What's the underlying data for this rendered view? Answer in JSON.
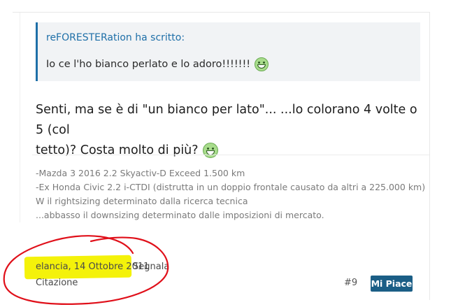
{
  "quote": {
    "author": "reFORESTERation ha scritto:",
    "text": "Io ce l'ho bianco perlato e lo adoro!!!!!!!",
    "emoji": "grin-icon"
  },
  "post": {
    "body_line1": "Senti, ma se è di \"un bianco per lato\"... ...lo colorano 4 volte o 5 (col",
    "body_line2": "tetto)? Costa molto di più?",
    "emoji": "grin-icon"
  },
  "signature": [
    "-Mazda 3 2016 2.2 Skyactiv-D Exceed 1.500 km",
    "-Ex Honda Civic 2.2 i-CTDI (distrutta in un doppio frontale causato da altri a 225.000 km)",
    "W il rightsizing determinato dalla ricerca tecnica",
    "...abbasso il downsizing determinato dalle imposizioni di mercato."
  ],
  "footer": {
    "date": "elancia, 14 Ottobre 2011",
    "report": "Segnala",
    "quote": "Citazione",
    "post_number": "#9",
    "like": "Mi Piace"
  },
  "colors": {
    "accent": "#1e6fa8",
    "like_button": "#1b5e86",
    "highlight": "#f4f20a",
    "annotation": "#e0101a"
  }
}
